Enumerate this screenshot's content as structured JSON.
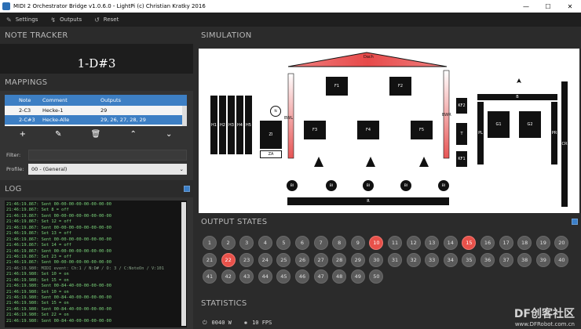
{
  "window": {
    "title": "MIDI 2 Orchestrator Bridge v1.0.6.0 - LightPi (c) Christian Kratky 2016",
    "minimize": "—",
    "maximize": "☐",
    "close": "✕"
  },
  "menu": [
    {
      "icon": "wrench-icon",
      "glyph": "✎",
      "label": "Settings"
    },
    {
      "icon": "outputs-icon",
      "glyph": "↯",
      "label": "Outputs"
    },
    {
      "icon": "reset-icon",
      "glyph": "↺",
      "label": "Reset"
    }
  ],
  "note_tracker": {
    "title": "NOTE TRACKER",
    "value": "1-D#3"
  },
  "mappings": {
    "title": "MAPPINGS",
    "columns": [
      "Note",
      "Comment",
      "Outputs"
    ],
    "rows": [
      {
        "note": "2-C3",
        "comment": "Hecke-1",
        "outputs": "29"
      },
      {
        "note": "2-C#3",
        "comment": "Hecke-Alle",
        "outputs": "29, 26, 27, 28, 29"
      }
    ],
    "tools": [
      "+",
      "✎",
      "🗑",
      "⌃",
      "⌄"
    ]
  },
  "filter": {
    "label": "Filter:",
    "value": ""
  },
  "profile": {
    "label": "Profile:",
    "value": "00 - (General)"
  },
  "log": {
    "title": "LOG",
    "lines": [
      "21:46:19.867: Sent 00-00-00-00-00-00-00-00",
      "21:46:19.867: Set 8 = off",
      "21:46:19.867: Sent 00-00-00-00-00-00-00-00",
      "21:46:19.867: Set 12 = off",
      "21:46:19.867: Sent 00-00-00-00-00-00-00-00",
      "21:46:19.867: Set 13 = off",
      "21:46:19.867: Sent 00-00-00-00-00-00-00-00",
      "21:46:19.867: Set 14 = off",
      "21:46:19.867: Sent 00-00-00-00-00-00-00-00",
      "21:46:19.867: Set 23 = off",
      "21:46:19.867: Sent 00-00-00-00-00-00-00-00",
      "21:46:19.980: MIDI event: Ch:1 / N:D# / O: 3 / C:NoteOn / V:101",
      "21:46:19.980: Set 10 = on",
      "21:46:19.980: Set 15 = on",
      "21:46:19.980: Sent 00-84-40-00-00-00-00-00",
      "21:46:19.980: Set 10 = on",
      "21:46:19.980: Sent 00-84-40-00-00-00-00-00",
      "21:46:19.980: Set 15 = on",
      "21:46:19.980: Sent 00-84-40-00-00-00-00-00",
      "21:46:19.980: Set 22 = on",
      "21:46:19.980: Sent 00-84-40-00-00-00-00-00"
    ]
  },
  "simulation": {
    "title": "SIMULATION",
    "labels": {
      "dach": "Dach",
      "f1": "F1",
      "f2": "F2",
      "f3": "F3",
      "f4": "F4",
      "f5": "F5",
      "zi": "ZI",
      "za": "ZA",
      "n": "N",
      "kf2": "KF2",
      "kf1": "KF1",
      "t": "T",
      "b": "B",
      "g1": "G1",
      "g2": "G2",
      "pl": "PL",
      "pr": "PR",
      "cr": "CR",
      "r": "R",
      "bwl": "BWL",
      "bwr": "BWR",
      "bi": "BI",
      "h1": "H1",
      "h2": "H2",
      "h3": "H3",
      "h4": "H4",
      "h5": "H5"
    }
  },
  "output_states": {
    "title": "OUTPUT STATES",
    "count": 50,
    "active": [
      10,
      15,
      22
    ]
  },
  "statistics": {
    "title": "STATISTICS",
    "power": "0040 W",
    "fps": "10 FPS"
  },
  "watermark": {
    "main": "DF创客社区",
    "url": "www.DFRobot.com.cn"
  },
  "colors": {
    "accent": "#3d7fc4",
    "on": "#e8514a",
    "off": "#5a5a5a"
  }
}
